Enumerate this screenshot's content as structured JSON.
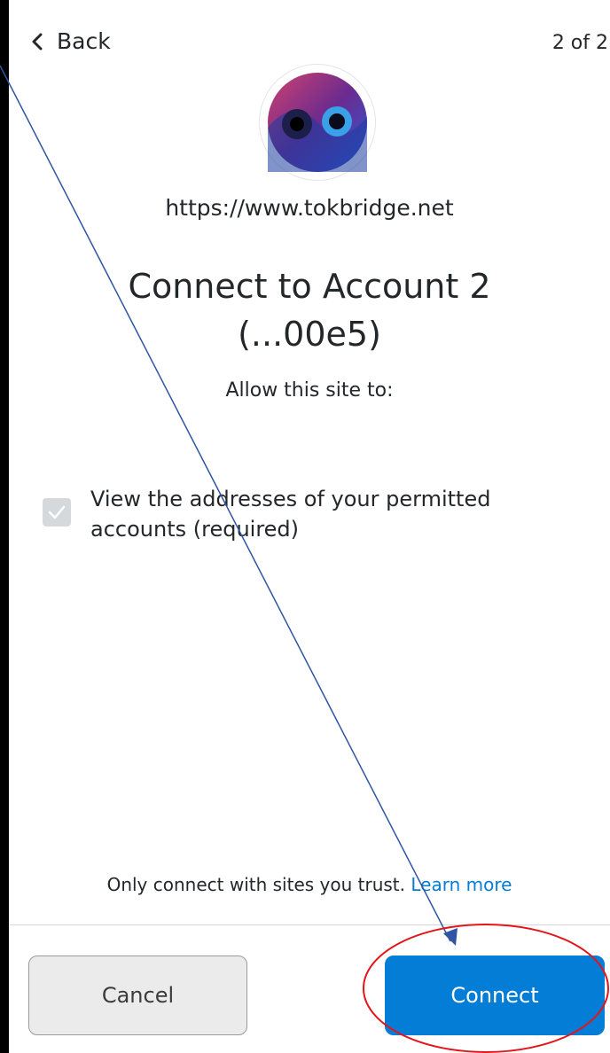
{
  "header": {
    "back_label": "Back",
    "step_counter": "2 of 2"
  },
  "site": {
    "icon": "tokbridge-site-icon",
    "url": "https://www.tokbridge.net"
  },
  "connect": {
    "title_line1": "Connect to Account 2",
    "title_line2": "(...00e5)",
    "subtitle": "Allow this site to:"
  },
  "permissions": [
    {
      "label_line1": "View the addresses of your permitted",
      "label_line2": "accounts (required)",
      "checked": true
    }
  ],
  "footer": {
    "trust_text": "Only connect with sites you trust.",
    "learn_more": "Learn more",
    "cancel_label": "Cancel",
    "connect_label": "Connect"
  },
  "colors": {
    "accent": "#037dd6",
    "annotation_circle": "#e4141b",
    "annotation_arrow": "#2f55a4"
  }
}
